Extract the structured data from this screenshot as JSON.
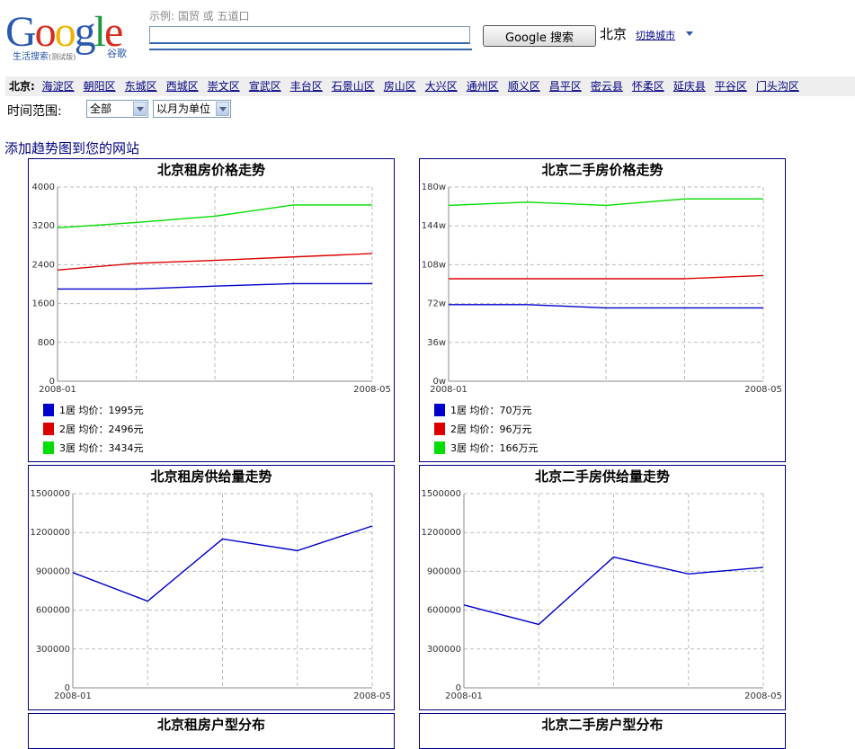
{
  "header": {
    "logo_text": [
      "G",
      "o",
      "o",
      "g",
      "l",
      "e"
    ],
    "logo_colors": [
      "#2a5ab0",
      "#d62d20",
      "#f0b400",
      "#2a5ab0",
      "#1a9a3a",
      "#d62d20"
    ],
    "logo_subtitle": "生活搜索",
    "logo_subtitle_beta": "(测试版)",
    "logo_cn": "谷歌",
    "example_text": "示例: 国贸  或  五道口",
    "search_value": "",
    "search_button": "Google 搜索",
    "city": "北京",
    "switch_city": "切换城市"
  },
  "districts": {
    "label": "北京:",
    "items": [
      "海淀区",
      "朝阳区",
      "东城区",
      "西城区",
      "崇文区",
      "宣武区",
      "丰台区",
      "石景山区",
      "房山区",
      "大兴区",
      "通州区",
      "顺义区",
      "昌平区",
      "密云县",
      "怀柔区",
      "延庆县",
      "平谷区",
      "门头沟区"
    ]
  },
  "filters": {
    "time_label": "时间范围:",
    "range_value": "全部",
    "unit_value": "以月为单位"
  },
  "add_trend_link": "添加趋势图到您的网站",
  "colors": {
    "series1": "#0000cc",
    "series2": "#dd0000",
    "series3": "#00dd00",
    "border": "#000080"
  },
  "chart_data": [
    {
      "type": "line",
      "title": "北京租房价格走势",
      "x": [
        "2008-01",
        "2008-02",
        "2008-03",
        "2008-04",
        "2008-05"
      ],
      "xticklabels": [
        "2008-01",
        "",
        "",
        "",
        "2008-05"
      ],
      "yticks": [
        "0",
        "800",
        "1600",
        "2400",
        "3200",
        "4000"
      ],
      "ylim": [
        0,
        4000
      ],
      "grid": true,
      "series": [
        {
          "name": "1居",
          "color": "#0000cc",
          "values": [
            1900,
            1900,
            1960,
            2010,
            2010
          ]
        },
        {
          "name": "2居",
          "color": "#dd0000",
          "values": [
            2290,
            2430,
            2490,
            2560,
            2630
          ]
        },
        {
          "name": "3居",
          "color": "#00dd00",
          "values": [
            3160,
            3270,
            3400,
            3630,
            3630
          ]
        }
      ],
      "legend": [
        "1居  均价：1995元",
        "2居  均价：2496元",
        "3居  均价：3434元"
      ]
    },
    {
      "type": "line",
      "title": "北京二手房价格走势",
      "x": [
        "2008-01",
        "2008-02",
        "2008-03",
        "2008-04",
        "2008-05"
      ],
      "xticklabels": [
        "2008-01",
        "",
        "",
        "",
        "2008-05"
      ],
      "yticks": [
        "0w",
        "36w",
        "72w",
        "108w",
        "144w",
        "180w"
      ],
      "ylim": [
        0,
        180
      ],
      "grid": true,
      "series": [
        {
          "name": "1居",
          "color": "#0000cc",
          "values": [
            71,
            71,
            68,
            68,
            68
          ]
        },
        {
          "name": "2居",
          "color": "#dd0000",
          "values": [
            95,
            95,
            95,
            95,
            98
          ]
        },
        {
          "name": "3居",
          "color": "#00dd00",
          "values": [
            163,
            166,
            163,
            169,
            169
          ]
        }
      ],
      "legend": [
        "1居  均价：70万元",
        "2居  均价：96万元",
        "3居  均价：166万元"
      ]
    },
    {
      "type": "line",
      "title": "北京租房供给量走势",
      "x": [
        "2008-01",
        "2008-02",
        "2008-03",
        "2008-04",
        "2008-05"
      ],
      "xticklabels": [
        "2008-01",
        "",
        "",
        "",
        "2008-05"
      ],
      "yticks": [
        "0",
        "300000",
        "600000",
        "900000",
        "1200000",
        "1500000"
      ],
      "ylim": [
        0,
        1500000
      ],
      "grid": true,
      "series": [
        {
          "color": "#0000cc",
          "values": [
            890000,
            670000,
            1150000,
            1060000,
            1250000
          ]
        }
      ]
    },
    {
      "type": "line",
      "title": "北京二手房供给量走势",
      "x": [
        "2008-01",
        "2008-02",
        "2008-03",
        "2008-04",
        "2008-05"
      ],
      "xticklabels": [
        "2008-01",
        "",
        "",
        "",
        "2008-05"
      ],
      "yticks": [
        "0",
        "300000",
        "600000",
        "900000",
        "1200000",
        "1500000"
      ],
      "ylim": [
        0,
        1500000
      ],
      "grid": true,
      "series": [
        {
          "color": "#0000cc",
          "values": [
            640000,
            490000,
            1010000,
            880000,
            930000
          ]
        }
      ]
    },
    {
      "type": "pie",
      "title": "北京租房户型分布"
    },
    {
      "type": "pie",
      "title": "北京二手房户型分布"
    }
  ]
}
